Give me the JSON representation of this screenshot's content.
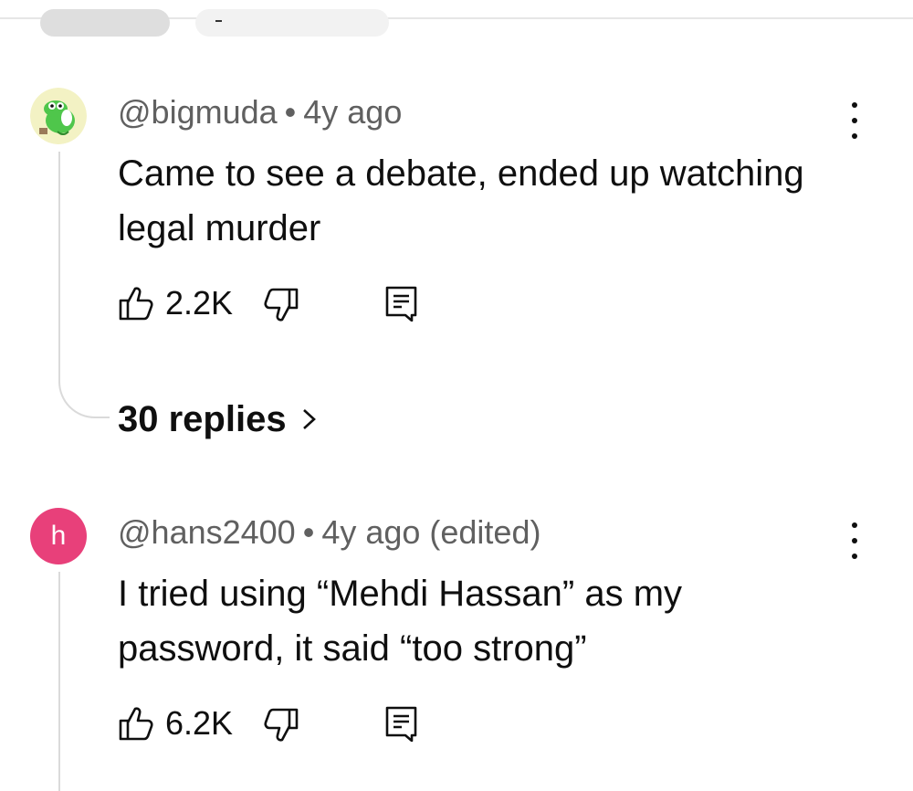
{
  "comments": [
    {
      "handle": "@bigmuda",
      "age": "4y ago",
      "text": "Came to see a debate, ended up watching legal murder",
      "likes": "2.2K",
      "avatar_icon": "frog-avatar-icon",
      "replies": "30 replies"
    },
    {
      "handle": "@hans2400",
      "age": "4y ago (edited)",
      "text": "I tried using “Mehdi Hassan” as my password, it said “too strong”",
      "likes": "6.2K",
      "avatar_letter": "h",
      "avatar_color": "#e8407a"
    }
  ],
  "separator": "•"
}
